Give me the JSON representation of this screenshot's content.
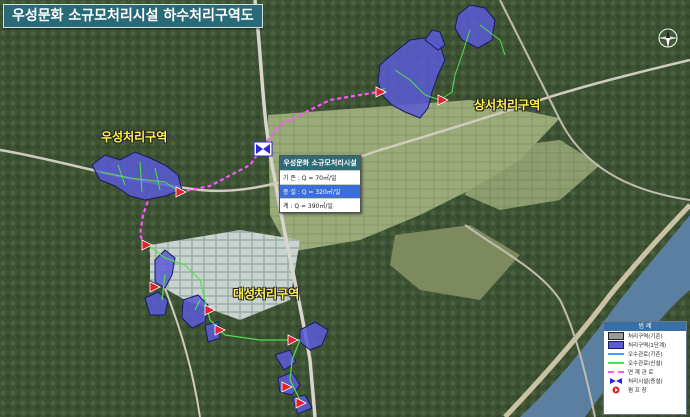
{
  "title": "우성문화 소규모처리시설 하수처리구역도",
  "areas": {
    "useong": "우성처리구역",
    "daeseong": "대성처리구역",
    "sangseo": "상서처리구역"
  },
  "facility": {
    "title": "우성문화 소규모처리시설",
    "existing": "기 존 : Q = 70㎥/일",
    "expansion": "증 설 : Q = 320㎥/일",
    "total": "계 : Q = 390㎥/일"
  },
  "legend": {
    "title": "범 례",
    "items": [
      {
        "label": "처리구역(기존)",
        "symbol": "box",
        "fill": "#9a9aa0",
        "stroke": "#222222"
      },
      {
        "label": "처리구역(1단계)",
        "symbol": "box",
        "fill": "#5b5bd6",
        "stroke": "#1a1a60"
      },
      {
        "label": "오수관로(기존)",
        "symbol": "line",
        "color": "#3ba0ff",
        "style": "solid"
      },
      {
        "label": "오수관로(신설)",
        "symbol": "line",
        "color": "#4fe04f",
        "style": "solid"
      },
      {
        "label": "연 계 관 로",
        "symbol": "line",
        "color": "#ff55ff",
        "style": "dashed"
      },
      {
        "label": "처리시설(증설)",
        "symbol": "bowtie",
        "color": "#2b2bd0"
      },
      {
        "label": "펌 프 장",
        "symbol": "pump",
        "color": "#e0202a"
      }
    ]
  },
  "colors": {
    "zone_fill": "#5b5bd6",
    "sewer_new": "#4fe04f",
    "link_pipe": "#ff55ff",
    "pump": "#e0202a",
    "facility": "#2b2bd0",
    "label": "#fff24a"
  },
  "icons": [
    "compass-icon",
    "pump-station-icon",
    "treatment-facility-icon"
  ]
}
